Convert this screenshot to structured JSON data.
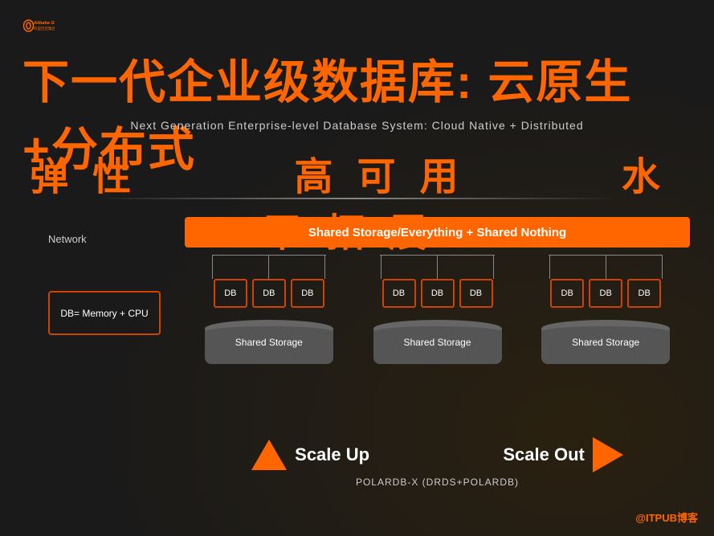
{
  "logo": {
    "brand": "Alibaba Group",
    "sub": "阿里巴巴集团"
  },
  "main_title": "下一代企业级数据库: 云原生+分布式",
  "subtitle": "Next Generation Enterprise-level Database System: Cloud Native + Distributed",
  "keywords": {
    "k1": "弹性",
    "k2": "高可用",
    "k3": "水平拓展"
  },
  "banner": "Shared Storage/Everything + Shared Nothing",
  "network_label": "Network",
  "db_memory_label": "DB= Memory + CPU",
  "db_label": "DB",
  "groups": [
    {
      "id": 1,
      "storage_label": "Shared Storage"
    },
    {
      "id": 2,
      "storage_label": "Shared Storage"
    },
    {
      "id": 3,
      "storage_label": "Shared Storage"
    }
  ],
  "scale_up": "Scale Up",
  "scale_out": "Scale Out",
  "polardb_label": "POLARDB-X (DRDS+POLARDB)",
  "watermark": "@ITPUB博客"
}
